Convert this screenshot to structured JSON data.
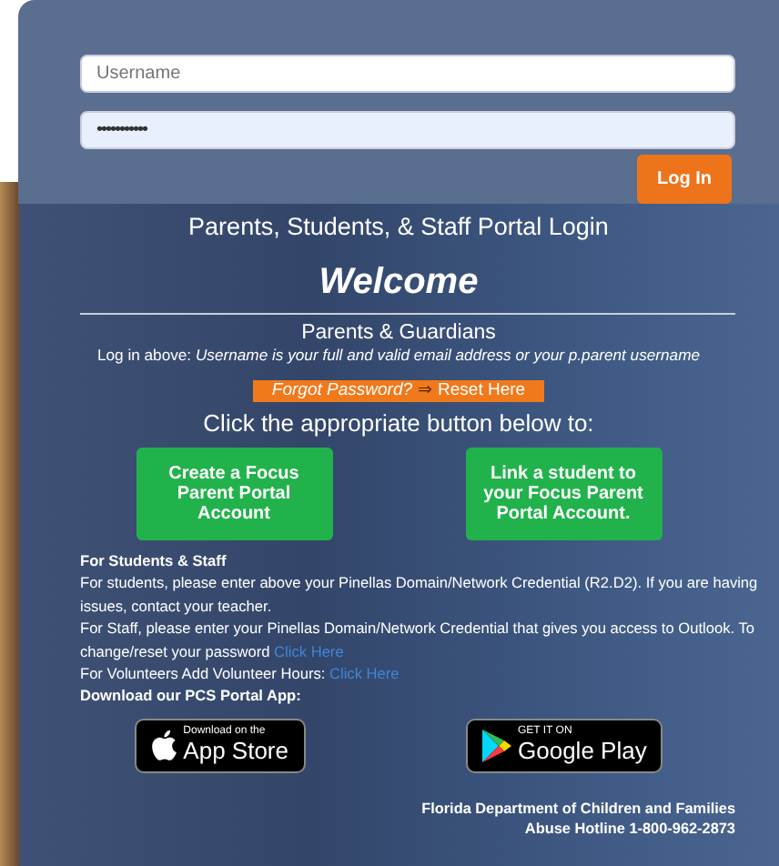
{
  "login_form": {
    "username": {
      "placeholder": "Username"
    },
    "password": {
      "value": "•••••••••••"
    },
    "login_button": "Log In"
  },
  "portal_title": "Parents, Students, & Staff Portal Login",
  "welcome": "Welcome",
  "parents": {
    "heading": "Parents & Guardians",
    "instruction": "Log in above: *Username is your full and valid email address or your p.parent username*",
    "forgot_password": "Forgot Password?",
    "arrow": "⇒",
    "reset_link": "Reset Here",
    "prompt": "Click the appropriate button below to:"
  },
  "account_buttons": [
    "Create a Focus Parent Portal Account",
    "Link a student to your Focus Parent Portal Account."
  ],
  "students_staff": {
    "heading": "For Students & Staff",
    "paragraphs": [
      {
        "text": "For students, please enter above your Pinellas Domain/Network Credential (R2.D2). If you are having issues, contact your teacher."
      },
      {
        "text": "For Staff, please enter your Pinellas Domain/Network Credential that gives you access to Outlook. To change/reset your password",
        "link": "Click Here"
      },
      {
        "text": "For Volunteers Add Volunteer Hours:",
        "link": "Click Here"
      }
    ],
    "app_heading": "Download our PCS Portal App:"
  },
  "app_badges": [
    {
      "kind": "apple",
      "small": "Download on the",
      "big": "App Store"
    },
    {
      "kind": "google",
      "small": "GET IT ON",
      "big": "Google Play"
    }
  ],
  "footer": [
    "Florida Department of Children and Families",
    "Abuse Hotline 1-800-962-2873"
  ]
}
